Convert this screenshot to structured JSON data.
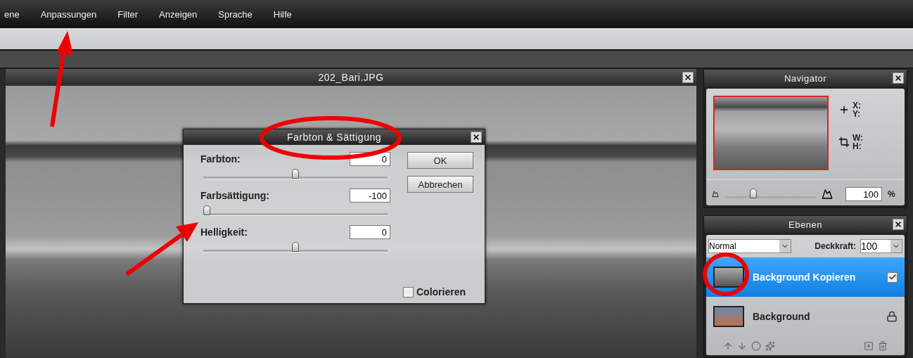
{
  "menu": [
    "ene",
    "Anpassungen",
    "Filter",
    "Anzeigen",
    "Sprache",
    "Hilfe"
  ],
  "document": {
    "title": "202_Bari.JPG"
  },
  "dialog": {
    "title": "Farbton & Sättigung",
    "sliders": [
      {
        "label": "Farbton:",
        "value": "0",
        "level": 0.5
      },
      {
        "label": "Farbsättigung:",
        "value": "-100",
        "level": 0
      },
      {
        "label": "Helligkeit:",
        "value": "0",
        "level": 0.5
      }
    ],
    "buttons": [
      "OK",
      "Abbrechen"
    ],
    "colorize": {
      "label": "Colorieren",
      "checked": false
    }
  },
  "navigator": {
    "title": "Navigator",
    "coords": [
      "X:",
      "Y:"
    ],
    "size": [
      "W:",
      "H:"
    ],
    "zoom": {
      "value": "100",
      "unit": "%",
      "level": 0.3
    }
  },
  "layers": {
    "title": "Ebenen",
    "blend_mode": "Normal",
    "opacity_label": "Deckkraft:",
    "opacity": "100",
    "items": [
      {
        "name": "Background Kopieren",
        "selected": true,
        "kind": "checkbox",
        "checked": true
      },
      {
        "name": "Background",
        "selected": false,
        "kind": "locked"
      }
    ]
  }
}
